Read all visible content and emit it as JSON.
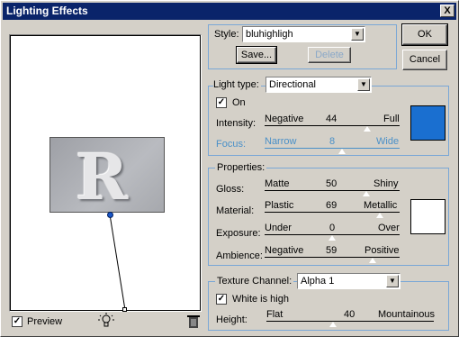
{
  "window": {
    "title": "Lighting Effects",
    "close_glyph": "X"
  },
  "style": {
    "label": "Style:",
    "value": "bluhighligh",
    "save_label": "Save...",
    "delete_label": "Delete"
  },
  "buttons": {
    "ok": "OK",
    "cancel": "Cancel"
  },
  "light": {
    "type_label": "Light type:",
    "type_value": "Directional",
    "on_label": "On",
    "on_checked": true,
    "intensity": {
      "label": "Intensity:",
      "min": "Negative",
      "value": "44",
      "max": "Full",
      "fraction": 0.76
    },
    "focus": {
      "label": "Focus:",
      "min": "Narrow",
      "value": "8",
      "max": "Wide",
      "fraction": 0.57
    },
    "color": "#1a6fd0"
  },
  "properties": {
    "label": "Properties:",
    "gloss": {
      "label": "Gloss:",
      "min": "Matte",
      "value": "50",
      "max": "Shiny",
      "fraction": 0.75
    },
    "material": {
      "label": "Material:",
      "min": "Plastic",
      "value": "69",
      "max": "Metallic",
      "fraction": 0.85
    },
    "exposure": {
      "label": "Exposure:",
      "min": "Under",
      "value": "0",
      "max": "Over",
      "fraction": 0.5
    },
    "ambience": {
      "label": "Ambience:",
      "min": "Negative",
      "value": "59",
      "max": "Positive",
      "fraction": 0.8
    },
    "color": "#ffffff"
  },
  "texture": {
    "label": "Texture Channel:",
    "value": "Alpha 1",
    "white_is_high_label": "White is high",
    "white_is_high_checked": true,
    "height": {
      "label": "Height:",
      "min": "Flat",
      "value": "40",
      "max": "Mountainous",
      "fraction": 0.4
    }
  },
  "preview": {
    "label": "Preview",
    "checked": true,
    "bulb_icon": "lightbulb-icon",
    "trash_icon": "trash-icon",
    "letter": "R"
  }
}
